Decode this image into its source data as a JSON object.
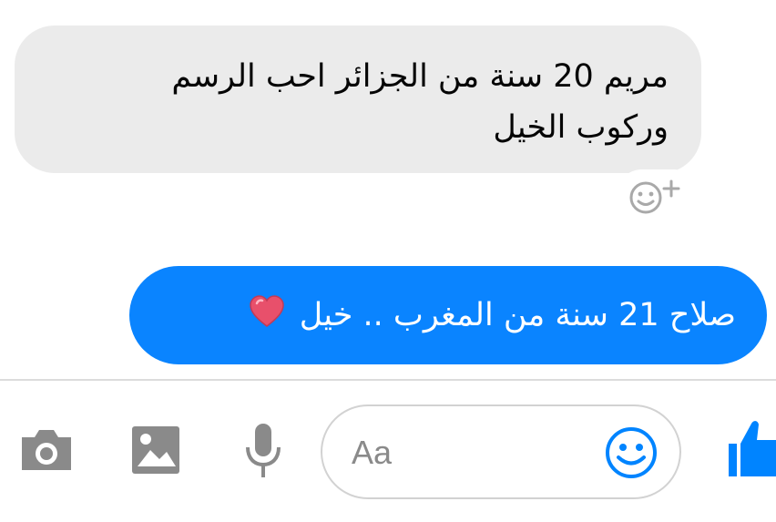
{
  "messages": {
    "incoming": {
      "line1": "مريم 20 سنة من الجزائر احب الرسم",
      "line2": "وركوب الخيل"
    },
    "outgoing": {
      "text": "صلاح 21 سنة من المغرب .. خيل",
      "emoji": "red-heart"
    }
  },
  "reaction": {
    "icon": "add-reaction-icon"
  },
  "composer": {
    "placeholder": "Aa",
    "icons": [
      "camera-icon",
      "image-icon",
      "microphone-icon",
      "emoji-icon",
      "thumbs-up-icon"
    ],
    "accent_color": "#0084ff",
    "icon_color": "#8a8a8a"
  }
}
